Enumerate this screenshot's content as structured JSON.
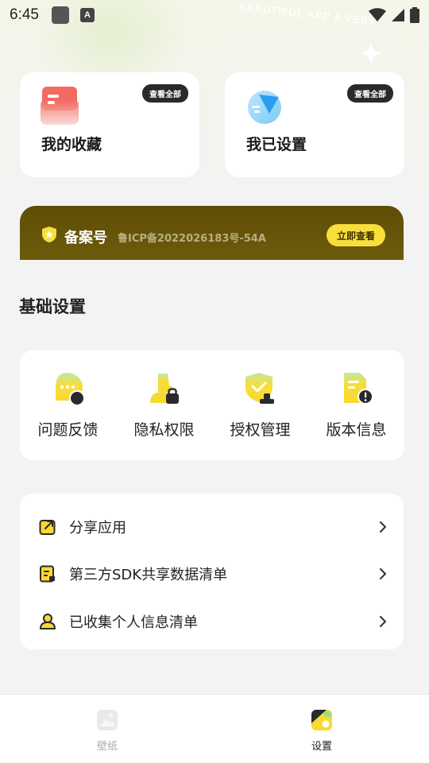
{
  "status_bar": {
    "time": "6:45",
    "app_badge": "A"
  },
  "background_text": "BEAUTIFUL APP  A VERY",
  "top_cards": [
    {
      "label": "我的收藏",
      "view_all": "查看全部",
      "icon": "favorites-card-icon"
    },
    {
      "label": "我已设置",
      "view_all": "查看全部",
      "icon": "settings-done-icon"
    }
  ],
  "icp": {
    "title": "备案号",
    "number": "鲁ICP备2022026183号-54A",
    "button": "立即查看"
  },
  "section_title": "基础设置",
  "grid": [
    {
      "label": "问题反馈",
      "icon": "feedback-icon"
    },
    {
      "label": "隐私权限",
      "icon": "privacy-icon"
    },
    {
      "label": "授权管理",
      "icon": "authorization-icon"
    },
    {
      "label": "版本信息",
      "icon": "version-info-icon"
    }
  ],
  "list": [
    {
      "label": "分享应用",
      "icon": "share-icon"
    },
    {
      "label": "第三方SDK共享数据清单",
      "icon": "sdk-list-icon"
    },
    {
      "label": "已收集个人信息清单",
      "icon": "personal-info-icon"
    }
  ],
  "bottom_nav": [
    {
      "label": "壁纸",
      "active": false
    },
    {
      "label": "设置",
      "active": true
    }
  ],
  "colors": {
    "accent_yellow": "#f7de3a",
    "banner_brown": "#5e4d05",
    "dark_pill": "#2a2a2a",
    "background": "#f3f3f3"
  }
}
